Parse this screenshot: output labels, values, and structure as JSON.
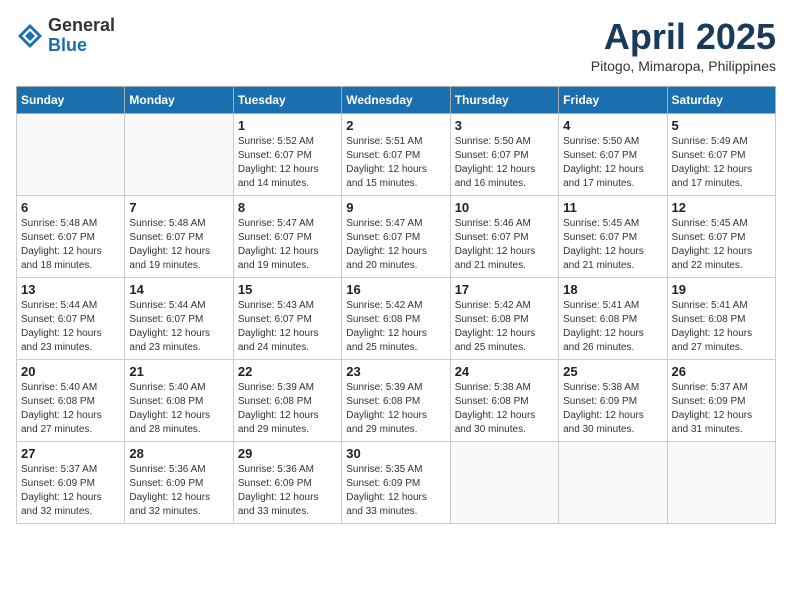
{
  "header": {
    "logo_general": "General",
    "logo_blue": "Blue",
    "month_title": "April 2025",
    "subtitle": "Pitogo, Mimaropa, Philippines"
  },
  "weekdays": [
    "Sunday",
    "Monday",
    "Tuesday",
    "Wednesday",
    "Thursday",
    "Friday",
    "Saturday"
  ],
  "weeks": [
    [
      {
        "day": "",
        "info": ""
      },
      {
        "day": "",
        "info": ""
      },
      {
        "day": "1",
        "info": "Sunrise: 5:52 AM\nSunset: 6:07 PM\nDaylight: 12 hours and 14 minutes."
      },
      {
        "day": "2",
        "info": "Sunrise: 5:51 AM\nSunset: 6:07 PM\nDaylight: 12 hours and 15 minutes."
      },
      {
        "day": "3",
        "info": "Sunrise: 5:50 AM\nSunset: 6:07 PM\nDaylight: 12 hours and 16 minutes."
      },
      {
        "day": "4",
        "info": "Sunrise: 5:50 AM\nSunset: 6:07 PM\nDaylight: 12 hours and 17 minutes."
      },
      {
        "day": "5",
        "info": "Sunrise: 5:49 AM\nSunset: 6:07 PM\nDaylight: 12 hours and 17 minutes."
      }
    ],
    [
      {
        "day": "6",
        "info": "Sunrise: 5:48 AM\nSunset: 6:07 PM\nDaylight: 12 hours and 18 minutes."
      },
      {
        "day": "7",
        "info": "Sunrise: 5:48 AM\nSunset: 6:07 PM\nDaylight: 12 hours and 19 minutes."
      },
      {
        "day": "8",
        "info": "Sunrise: 5:47 AM\nSunset: 6:07 PM\nDaylight: 12 hours and 19 minutes."
      },
      {
        "day": "9",
        "info": "Sunrise: 5:47 AM\nSunset: 6:07 PM\nDaylight: 12 hours and 20 minutes."
      },
      {
        "day": "10",
        "info": "Sunrise: 5:46 AM\nSunset: 6:07 PM\nDaylight: 12 hours and 21 minutes."
      },
      {
        "day": "11",
        "info": "Sunrise: 5:45 AM\nSunset: 6:07 PM\nDaylight: 12 hours and 21 minutes."
      },
      {
        "day": "12",
        "info": "Sunrise: 5:45 AM\nSunset: 6:07 PM\nDaylight: 12 hours and 22 minutes."
      }
    ],
    [
      {
        "day": "13",
        "info": "Sunrise: 5:44 AM\nSunset: 6:07 PM\nDaylight: 12 hours and 23 minutes."
      },
      {
        "day": "14",
        "info": "Sunrise: 5:44 AM\nSunset: 6:07 PM\nDaylight: 12 hours and 23 minutes."
      },
      {
        "day": "15",
        "info": "Sunrise: 5:43 AM\nSunset: 6:07 PM\nDaylight: 12 hours and 24 minutes."
      },
      {
        "day": "16",
        "info": "Sunrise: 5:42 AM\nSunset: 6:08 PM\nDaylight: 12 hours and 25 minutes."
      },
      {
        "day": "17",
        "info": "Sunrise: 5:42 AM\nSunset: 6:08 PM\nDaylight: 12 hours and 25 minutes."
      },
      {
        "day": "18",
        "info": "Sunrise: 5:41 AM\nSunset: 6:08 PM\nDaylight: 12 hours and 26 minutes."
      },
      {
        "day": "19",
        "info": "Sunrise: 5:41 AM\nSunset: 6:08 PM\nDaylight: 12 hours and 27 minutes."
      }
    ],
    [
      {
        "day": "20",
        "info": "Sunrise: 5:40 AM\nSunset: 6:08 PM\nDaylight: 12 hours and 27 minutes."
      },
      {
        "day": "21",
        "info": "Sunrise: 5:40 AM\nSunset: 6:08 PM\nDaylight: 12 hours and 28 minutes."
      },
      {
        "day": "22",
        "info": "Sunrise: 5:39 AM\nSunset: 6:08 PM\nDaylight: 12 hours and 29 minutes."
      },
      {
        "day": "23",
        "info": "Sunrise: 5:39 AM\nSunset: 6:08 PM\nDaylight: 12 hours and 29 minutes."
      },
      {
        "day": "24",
        "info": "Sunrise: 5:38 AM\nSunset: 6:08 PM\nDaylight: 12 hours and 30 minutes."
      },
      {
        "day": "25",
        "info": "Sunrise: 5:38 AM\nSunset: 6:09 PM\nDaylight: 12 hours and 30 minutes."
      },
      {
        "day": "26",
        "info": "Sunrise: 5:37 AM\nSunset: 6:09 PM\nDaylight: 12 hours and 31 minutes."
      }
    ],
    [
      {
        "day": "27",
        "info": "Sunrise: 5:37 AM\nSunset: 6:09 PM\nDaylight: 12 hours and 32 minutes."
      },
      {
        "day": "28",
        "info": "Sunrise: 5:36 AM\nSunset: 6:09 PM\nDaylight: 12 hours and 32 minutes."
      },
      {
        "day": "29",
        "info": "Sunrise: 5:36 AM\nSunset: 6:09 PM\nDaylight: 12 hours and 33 minutes."
      },
      {
        "day": "30",
        "info": "Sunrise: 5:35 AM\nSunset: 6:09 PM\nDaylight: 12 hours and 33 minutes."
      },
      {
        "day": "",
        "info": ""
      },
      {
        "day": "",
        "info": ""
      },
      {
        "day": "",
        "info": ""
      }
    ]
  ]
}
